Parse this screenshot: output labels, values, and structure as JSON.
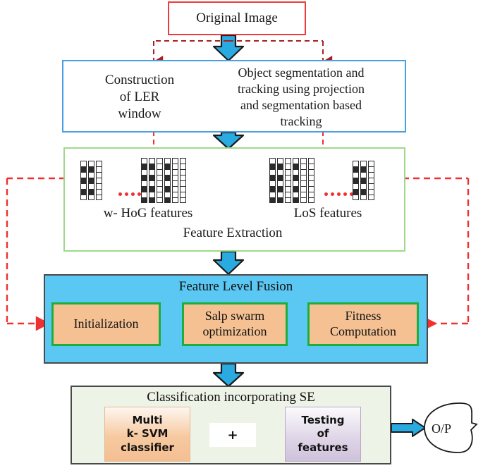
{
  "diagram": {
    "title": "Feature extraction and classification pipeline",
    "colors": {
      "original_border": "#ef3b3b",
      "stage2_border": "#4a9fe0",
      "feature_extraction_border": "#9ed98a",
      "fusion_fill": "#5ac8f2",
      "sub_block_fill": "#f5c193",
      "sub_block_border": "#1eae3c",
      "classification_fill": "#eef3e8",
      "svm_fill": "#f3bf92",
      "testing_fill": "#cfc2dc",
      "flow_arrow": "#29ABE2",
      "feedback_dashed": "#f03030",
      "top_dashed": "#a82020",
      "inner_arrow": "#f21010"
    }
  },
  "nodes": {
    "original_image": "Original Image",
    "construction_ler": "Construction\nof LER\nwindow",
    "construction_ler_lines": [
      "Construction",
      "of LER",
      "window"
    ],
    "object_segmentation": "Object segmentation and tracking using projection and segmentation based tracking",
    "object_segmentation_lines": [
      "Object segmentation and",
      "tracking using projection",
      "and segmentation based",
      "tracking"
    ],
    "whog_features": "w- HoG features",
    "los_features": "LoS features",
    "feature_extraction": "Feature Extraction",
    "feature_level_fusion": "Feature Level Fusion",
    "initialization": "Initialization",
    "salp_swarm_optimization": "Salp swarm\noptimization",
    "salp_swarm_lines": [
      "Salp swarm",
      "optimization"
    ],
    "fitness_computation": "Fitness\nComputation",
    "fitness_computation_lines": [
      "Fitness",
      "Computation"
    ],
    "classification_se": "Classification incorporating SE",
    "multi_ksvm": "Multi\nk- SVM\nclassifier",
    "multi_ksvm_lines": [
      "Multi",
      "k- SVM",
      "classifier"
    ],
    "plus": "+",
    "testing_features": "Testing\nof\nfeatures",
    "testing_features_lines": [
      "Testing",
      "of",
      "features"
    ],
    "output": "O/P"
  },
  "edges": [
    {
      "from": "original_image",
      "to": "object_segmentation",
      "style": "solid-blue-arrow"
    },
    {
      "from": "original_image",
      "to": "construction_ler",
      "style": "dashed-maroon-arrow"
    },
    {
      "from": "original_image",
      "to": "object_segmentation",
      "style": "dashed-maroon-arrow"
    },
    {
      "from": "construction_ler",
      "to": "whog_features",
      "style": "dashed-red-arrow"
    },
    {
      "from": "object_segmentation",
      "to": "los_features",
      "style": "dashed-red-arrow"
    },
    {
      "from": "object_segmentation",
      "to": "feature_extraction",
      "style": "solid-blue-arrow"
    },
    {
      "from": "feature_extraction",
      "to": "feature_level_fusion",
      "style": "solid-blue-arrow"
    },
    {
      "from": "whog_features",
      "to": "initialization",
      "style": "dashed-red-feedback-left"
    },
    {
      "from": "los_features",
      "to": "fitness_computation",
      "style": "dashed-red-feedback-right"
    },
    {
      "from": "initialization",
      "to": "salp_swarm_optimization",
      "style": "solid-red-arrow"
    },
    {
      "from": "salp_swarm_optimization",
      "to": "fitness_computation",
      "style": "solid-red-arrow"
    },
    {
      "from": "feature_level_fusion",
      "to": "classification_se",
      "style": "solid-blue-arrow"
    },
    {
      "from": "classification_se",
      "to": "output",
      "style": "solid-blue-arrow"
    }
  ]
}
